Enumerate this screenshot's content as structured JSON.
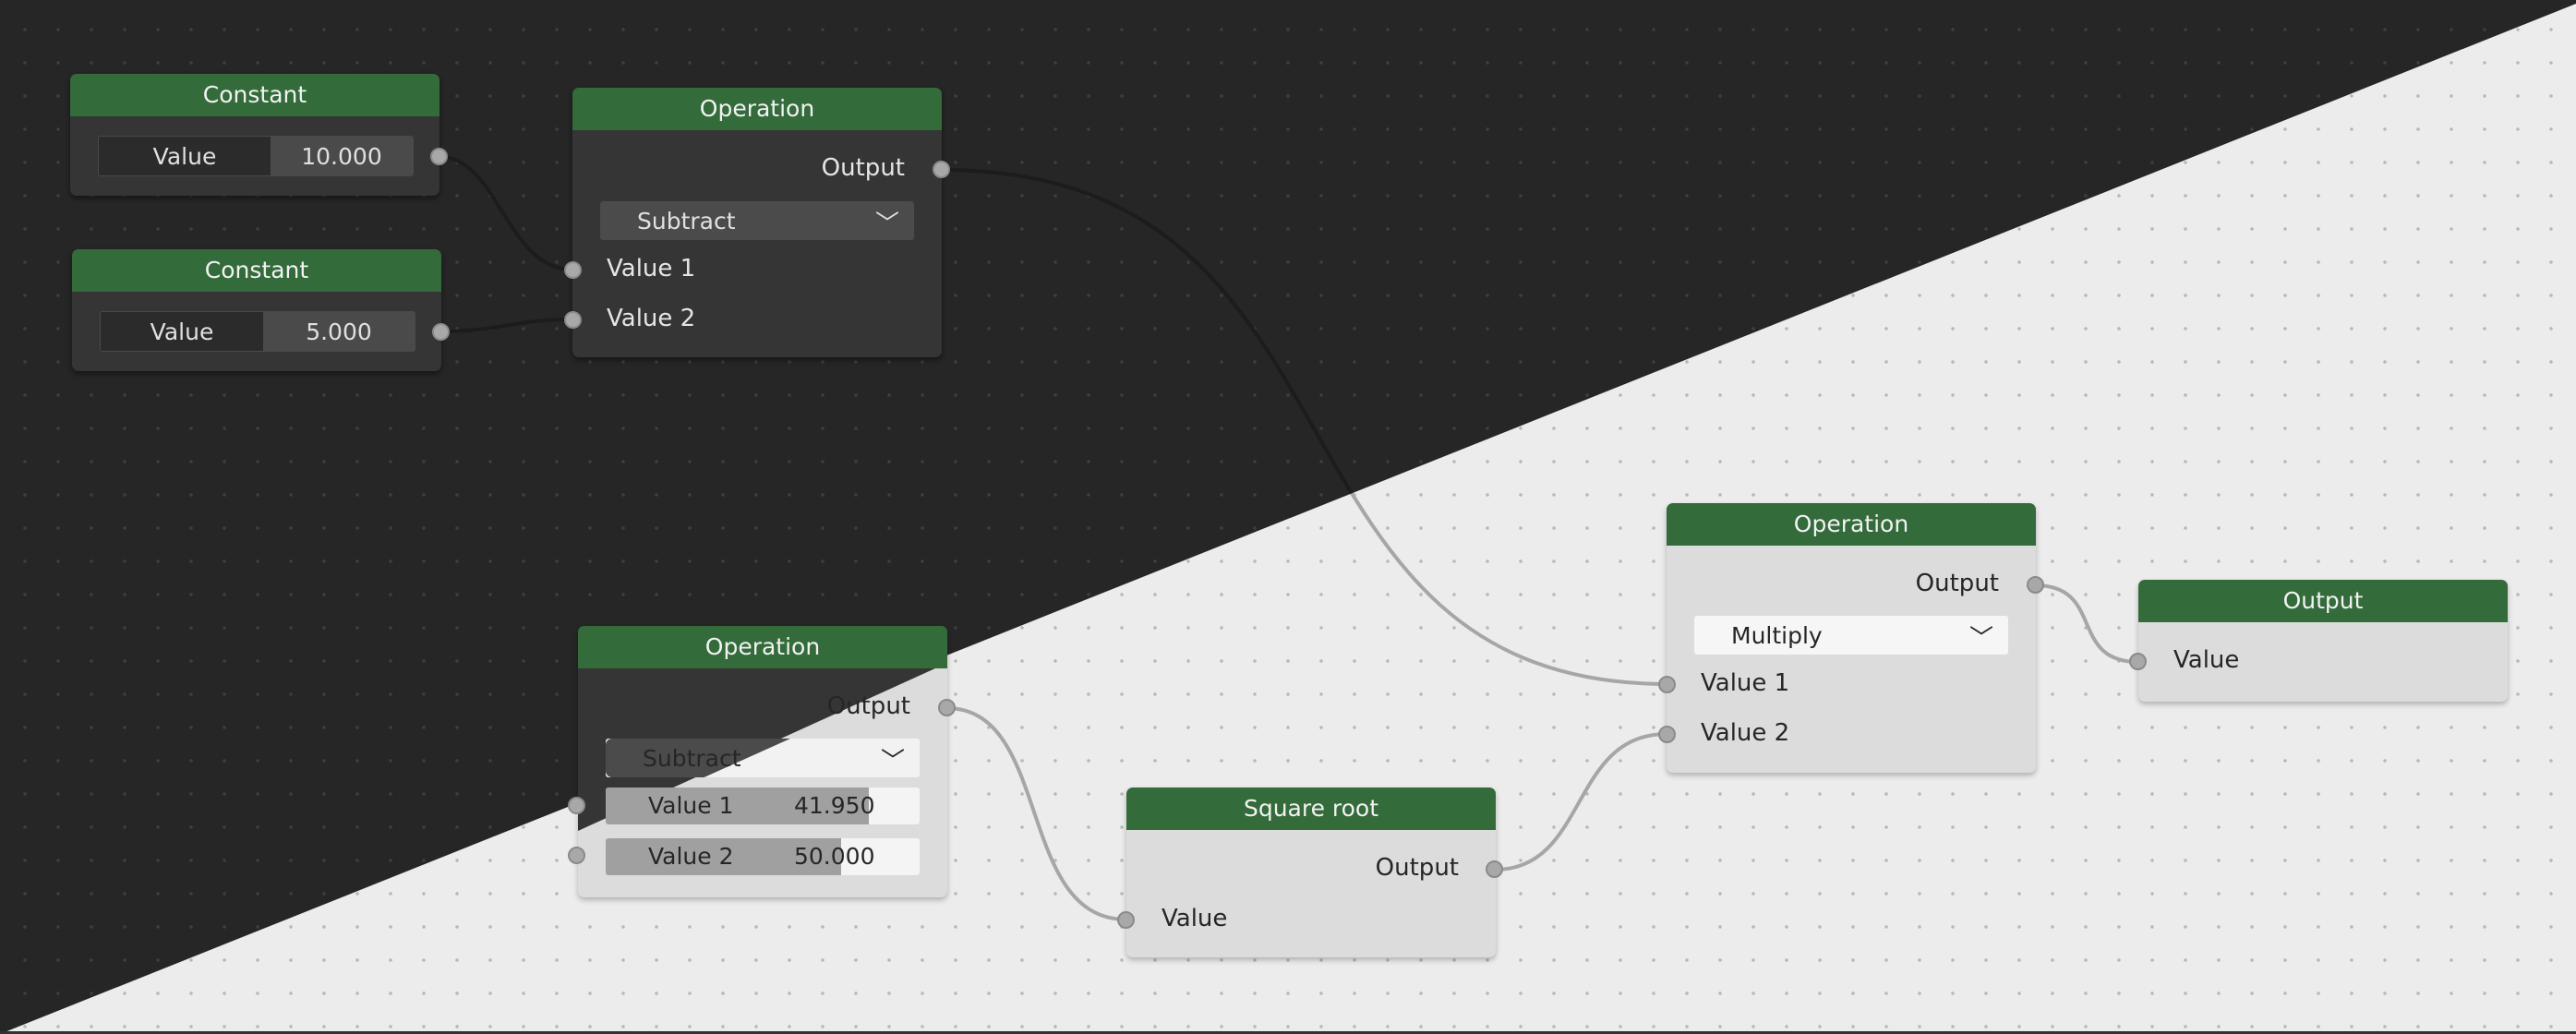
{
  "nodes": {
    "constant1": {
      "title": "Constant",
      "field_label": "Value",
      "field_value": "10.000"
    },
    "constant2": {
      "title": "Constant",
      "field_label": "Value",
      "field_value": "5.000"
    },
    "operation_top": {
      "title": "Operation",
      "output_label": "Output",
      "mode": "Subtract",
      "input1_label": "Value 1",
      "input2_label": "Value 2"
    },
    "operation_bottom": {
      "title": "Operation",
      "output_label": "Output",
      "mode": "Subtract",
      "input1_label": "Value 1",
      "input1_value": "41.950",
      "input1_fraction": 0.839,
      "input2_label": "Value 2",
      "input2_value": "50.000",
      "input2_fraction": 0.75
    },
    "square_root": {
      "title": "Square root",
      "output_label": "Output",
      "input_label": "Value"
    },
    "operation_right": {
      "title": "Operation",
      "output_label": "Output",
      "mode": "Multiply",
      "input1_label": "Value 1",
      "input2_label": "Value 2"
    },
    "output": {
      "title": "Output",
      "input_label": "Value"
    }
  },
  "icons": {
    "dropdown": "chevron-down-icon",
    "socket": "socket-dot-icon"
  },
  "colors": {
    "header": "#336b3a",
    "dark_bg": "#262626",
    "light_bg": "#ececec",
    "wire_dark": "#1a1a1a",
    "wire_light": "#a8a8a8"
  }
}
